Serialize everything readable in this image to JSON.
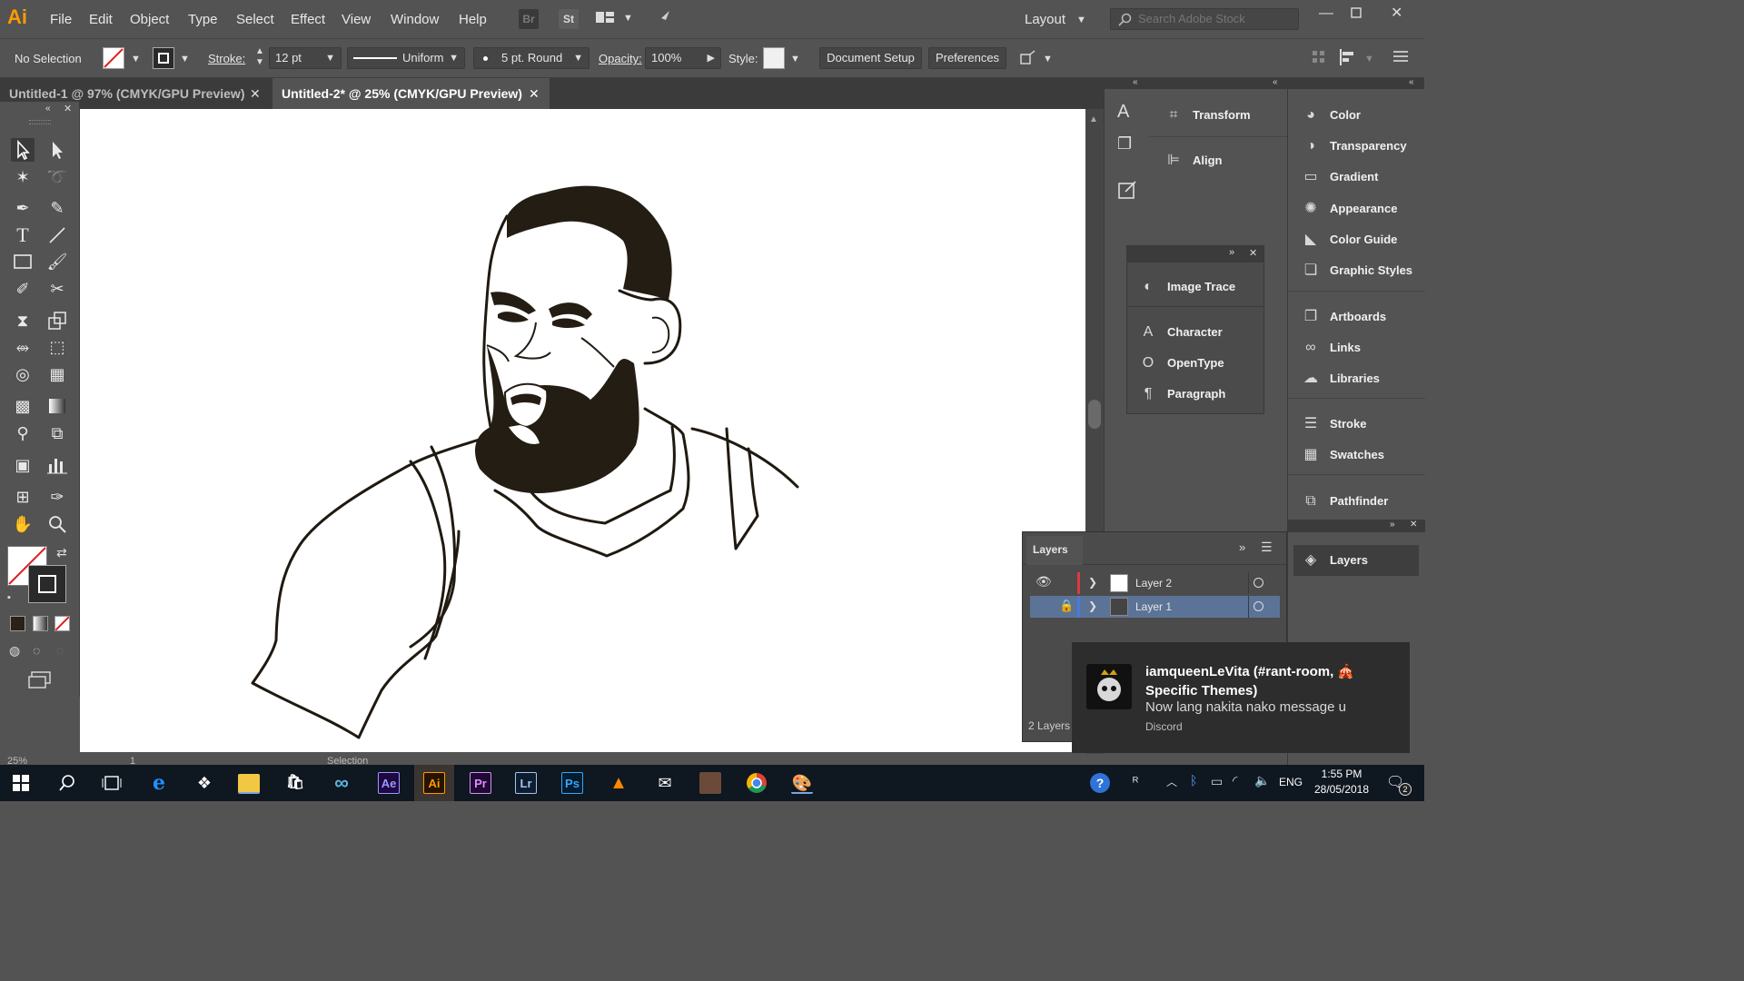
{
  "app": {
    "logo": "Ai",
    "menu": [
      "File",
      "Edit",
      "Object",
      "Type",
      "Select",
      "Effect",
      "View",
      "Window",
      "Help"
    ],
    "bridge_label": "Br",
    "stock_label": "St",
    "workspace": "Layout",
    "search_placeholder": "Search Adobe Stock",
    "accent_color": "#ff9a00"
  },
  "control_bar": {
    "selection": "No Selection",
    "stroke_label": "Stroke:",
    "stroke_value": "12 pt",
    "profile": "Uniform",
    "brush": "5 pt. Round",
    "opacity_label": "Opacity:",
    "opacity_value": "100%",
    "style_label": "Style:",
    "document_setup": "Document Setup",
    "preferences": "Preferences"
  },
  "tabs": [
    {
      "label": "Untitled-1 @ 97% (CMYK/GPU Preview)",
      "active": false
    },
    {
      "label": "Untitled-2* @ 25% (CMYK/GPU Preview)",
      "active": true
    }
  ],
  "panels": {
    "col2": [
      "Transform",
      "Align"
    ],
    "floating": [
      "Image Trace",
      "Character",
      "OpenType",
      "Paragraph"
    ],
    "col3": [
      "Color",
      "Transparency",
      "Gradient",
      "Appearance",
      "Color Guide",
      "Graphic Styles",
      "Artboards",
      "Links",
      "Libraries",
      "Stroke",
      "Swatches",
      "Pathfinder",
      "Layers"
    ]
  },
  "layers": {
    "title": "Layers",
    "rows": [
      {
        "name": "Layer 2",
        "color": "#e0393e",
        "selected": false
      },
      {
        "name": "Layer 1",
        "color": "#4a7bdc",
        "selected": true
      }
    ],
    "count": "2 Layers"
  },
  "status": {
    "zoom": "25%",
    "artboard": "1",
    "mode": "Selection"
  },
  "notification": {
    "title": "iamqueenLeVita (#rant-room, 🎪 Specific Themes)",
    "message": "Now lang nakita nako message u",
    "app": "Discord"
  },
  "taskbar": {
    "apps": [
      "Ae",
      "Ai",
      "Pr",
      "Lr",
      "Ps"
    ],
    "lang": "ENG",
    "time": "1:55 PM",
    "date": "28/05/2018",
    "notif_count": "2"
  }
}
